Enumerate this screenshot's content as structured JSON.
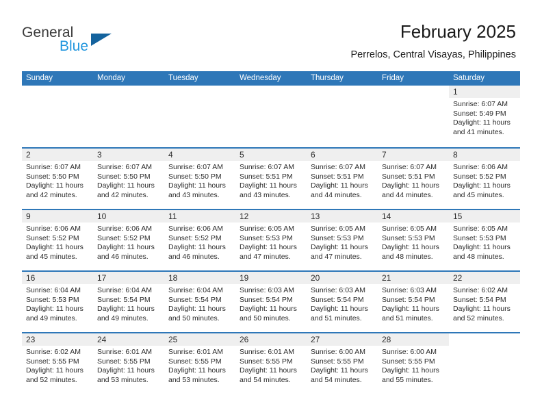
{
  "brand": {
    "name_part1": "General",
    "name_part2": "Blue",
    "flag_icon": "blue-triangle-flag-icon"
  },
  "header": {
    "title": "February 2025",
    "subtitle": "Perrelos, Central Visayas, Philippines"
  },
  "colors": {
    "header_blue": "#2e77b8",
    "brand_blue": "#2196de",
    "flag_blue": "#14639e",
    "band_gray": "#efefef",
    "text": "#2b2b2b"
  },
  "weekdays": [
    "Sunday",
    "Monday",
    "Tuesday",
    "Wednesday",
    "Thursday",
    "Friday",
    "Saturday"
  ],
  "weeks": [
    [
      {
        "empty": true
      },
      {
        "empty": true
      },
      {
        "empty": true
      },
      {
        "empty": true
      },
      {
        "empty": true
      },
      {
        "empty": true
      },
      {
        "day": "1",
        "sunrise": "Sunrise: 6:07 AM",
        "sunset": "Sunset: 5:49 PM",
        "daylight": "Daylight: 11 hours and 41 minutes."
      }
    ],
    [
      {
        "day": "2",
        "sunrise": "Sunrise: 6:07 AM",
        "sunset": "Sunset: 5:50 PM",
        "daylight": "Daylight: 11 hours and 42 minutes."
      },
      {
        "day": "3",
        "sunrise": "Sunrise: 6:07 AM",
        "sunset": "Sunset: 5:50 PM",
        "daylight": "Daylight: 11 hours and 42 minutes."
      },
      {
        "day": "4",
        "sunrise": "Sunrise: 6:07 AM",
        "sunset": "Sunset: 5:50 PM",
        "daylight": "Daylight: 11 hours and 43 minutes."
      },
      {
        "day": "5",
        "sunrise": "Sunrise: 6:07 AM",
        "sunset": "Sunset: 5:51 PM",
        "daylight": "Daylight: 11 hours and 43 minutes."
      },
      {
        "day": "6",
        "sunrise": "Sunrise: 6:07 AM",
        "sunset": "Sunset: 5:51 PM",
        "daylight": "Daylight: 11 hours and 44 minutes."
      },
      {
        "day": "7",
        "sunrise": "Sunrise: 6:07 AM",
        "sunset": "Sunset: 5:51 PM",
        "daylight": "Daylight: 11 hours and 44 minutes."
      },
      {
        "day": "8",
        "sunrise": "Sunrise: 6:06 AM",
        "sunset": "Sunset: 5:52 PM",
        "daylight": "Daylight: 11 hours and 45 minutes."
      }
    ],
    [
      {
        "day": "9",
        "sunrise": "Sunrise: 6:06 AM",
        "sunset": "Sunset: 5:52 PM",
        "daylight": "Daylight: 11 hours and 45 minutes."
      },
      {
        "day": "10",
        "sunrise": "Sunrise: 6:06 AM",
        "sunset": "Sunset: 5:52 PM",
        "daylight": "Daylight: 11 hours and 46 minutes."
      },
      {
        "day": "11",
        "sunrise": "Sunrise: 6:06 AM",
        "sunset": "Sunset: 5:52 PM",
        "daylight": "Daylight: 11 hours and 46 minutes."
      },
      {
        "day": "12",
        "sunrise": "Sunrise: 6:05 AM",
        "sunset": "Sunset: 5:53 PM",
        "daylight": "Daylight: 11 hours and 47 minutes."
      },
      {
        "day": "13",
        "sunrise": "Sunrise: 6:05 AM",
        "sunset": "Sunset: 5:53 PM",
        "daylight": "Daylight: 11 hours and 47 minutes."
      },
      {
        "day": "14",
        "sunrise": "Sunrise: 6:05 AM",
        "sunset": "Sunset: 5:53 PM",
        "daylight": "Daylight: 11 hours and 48 minutes."
      },
      {
        "day": "15",
        "sunrise": "Sunrise: 6:05 AM",
        "sunset": "Sunset: 5:53 PM",
        "daylight": "Daylight: 11 hours and 48 minutes."
      }
    ],
    [
      {
        "day": "16",
        "sunrise": "Sunrise: 6:04 AM",
        "sunset": "Sunset: 5:53 PM",
        "daylight": "Daylight: 11 hours and 49 minutes."
      },
      {
        "day": "17",
        "sunrise": "Sunrise: 6:04 AM",
        "sunset": "Sunset: 5:54 PM",
        "daylight": "Daylight: 11 hours and 49 minutes."
      },
      {
        "day": "18",
        "sunrise": "Sunrise: 6:04 AM",
        "sunset": "Sunset: 5:54 PM",
        "daylight": "Daylight: 11 hours and 50 minutes."
      },
      {
        "day": "19",
        "sunrise": "Sunrise: 6:03 AM",
        "sunset": "Sunset: 5:54 PM",
        "daylight": "Daylight: 11 hours and 50 minutes."
      },
      {
        "day": "20",
        "sunrise": "Sunrise: 6:03 AM",
        "sunset": "Sunset: 5:54 PM",
        "daylight": "Daylight: 11 hours and 51 minutes."
      },
      {
        "day": "21",
        "sunrise": "Sunrise: 6:03 AM",
        "sunset": "Sunset: 5:54 PM",
        "daylight": "Daylight: 11 hours and 51 minutes."
      },
      {
        "day": "22",
        "sunrise": "Sunrise: 6:02 AM",
        "sunset": "Sunset: 5:54 PM",
        "daylight": "Daylight: 11 hours and 52 minutes."
      }
    ],
    [
      {
        "day": "23",
        "sunrise": "Sunrise: 6:02 AM",
        "sunset": "Sunset: 5:55 PM",
        "daylight": "Daylight: 11 hours and 52 minutes."
      },
      {
        "day": "24",
        "sunrise": "Sunrise: 6:01 AM",
        "sunset": "Sunset: 5:55 PM",
        "daylight": "Daylight: 11 hours and 53 minutes."
      },
      {
        "day": "25",
        "sunrise": "Sunrise: 6:01 AM",
        "sunset": "Sunset: 5:55 PM",
        "daylight": "Daylight: 11 hours and 53 minutes."
      },
      {
        "day": "26",
        "sunrise": "Sunrise: 6:01 AM",
        "sunset": "Sunset: 5:55 PM",
        "daylight": "Daylight: 11 hours and 54 minutes."
      },
      {
        "day": "27",
        "sunrise": "Sunrise: 6:00 AM",
        "sunset": "Sunset: 5:55 PM",
        "daylight": "Daylight: 11 hours and 54 minutes."
      },
      {
        "day": "28",
        "sunrise": "Sunrise: 6:00 AM",
        "sunset": "Sunset: 5:55 PM",
        "daylight": "Daylight: 11 hours and 55 minutes."
      },
      {
        "empty": true
      }
    ]
  ]
}
